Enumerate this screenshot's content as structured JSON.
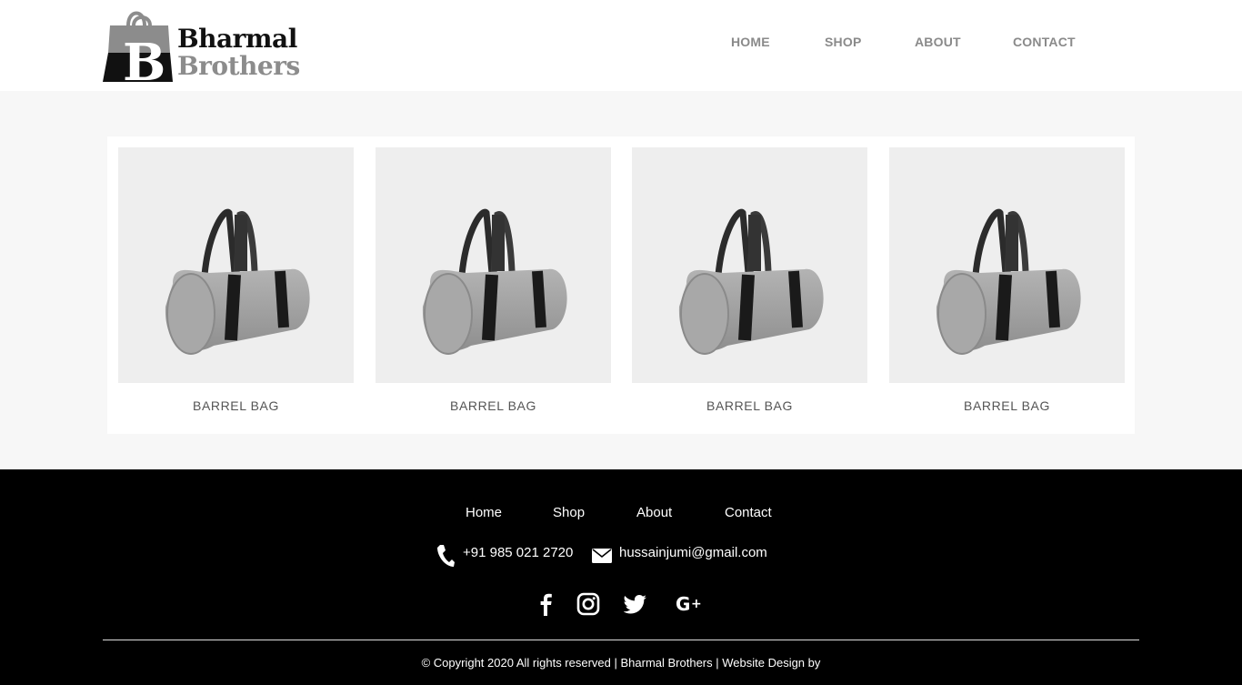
{
  "brand": {
    "logo_line1": "Bharmal",
    "logo_line2": "Brothers",
    "logo_letter": "B",
    "dark_color": "#111111",
    "grey_color": "#8c8c8c"
  },
  "nav": {
    "items": [
      {
        "label": "HOME"
      },
      {
        "label": "SHOP"
      },
      {
        "label": "ABOUT"
      },
      {
        "label": "CONTACT"
      }
    ]
  },
  "products": [
    {
      "title": "BARREL BAG",
      "image": "barrel-bag-image"
    },
    {
      "title": "BARREL BAG",
      "image": "barrel-bag-image"
    },
    {
      "title": "BARREL BAG",
      "image": "barrel-bag-image"
    },
    {
      "title": "BARREL BAG",
      "image": "barrel-bag-image"
    }
  ],
  "footer": {
    "links": [
      {
        "label": "Home"
      },
      {
        "label": "Shop"
      },
      {
        "label": "About"
      },
      {
        "label": "Contact"
      }
    ],
    "phone": "+91 985 021 2720",
    "email": "hussainjumi@gmail.com",
    "social": [
      "facebook-icon",
      "instagram-icon",
      "twitter-icon",
      "google-plus-icon"
    ],
    "copyright": "© Copyright 2020 All rights reserved | Bharmal Brothers | Website Design by"
  },
  "colors": {
    "nav_text": "#8a8a8a",
    "page_bg": "#f7f7f7",
    "footer_bg": "#000000"
  }
}
